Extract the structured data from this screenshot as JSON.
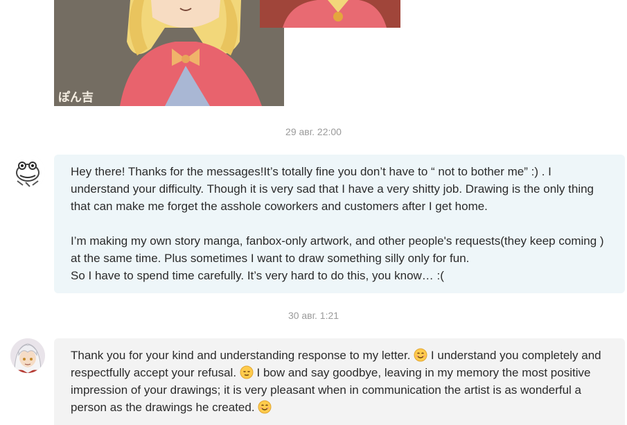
{
  "attachment": {
    "watermark": "ぽん吉"
  },
  "messages": [
    {
      "timestamp": "29 авг. 22:00",
      "avatar": "frog-sketch-avatar",
      "paragraphs": [
        "Hey there! Thanks for the messages!It’s totally fine you don’t have to “ not to bother me” :) . I understand your difficulty. Though it is very sad that I have a very shitty job. Drawing is the only thing that can make me forget the asshole coworkers and customers after I get home.",
        "I’m making my own story manga, fanbox-only artwork, and other people's requests(they keep coming ) at the same time. Plus sometimes I want to draw something silly only for fun.",
        "So I have to spend time carefully. It’s very hard to do this, you know… :("
      ]
    },
    {
      "timestamp": "30 авг. 1:21",
      "avatar": "anime-character-avatar",
      "segments": [
        "Thank you for your kind and understanding response to my letter.",
        "I understand you completely and respectfully accept your refusal.",
        "I bow and say goodbye, leaving in my memory the most positive impression of your drawings; it is very pleasant when in communication the artist is as wonderful a person as the drawings he created."
      ],
      "emojis": [
        "smiling-face-icon",
        "relieved-face-icon",
        "smiling-face-icon"
      ]
    }
  ]
}
